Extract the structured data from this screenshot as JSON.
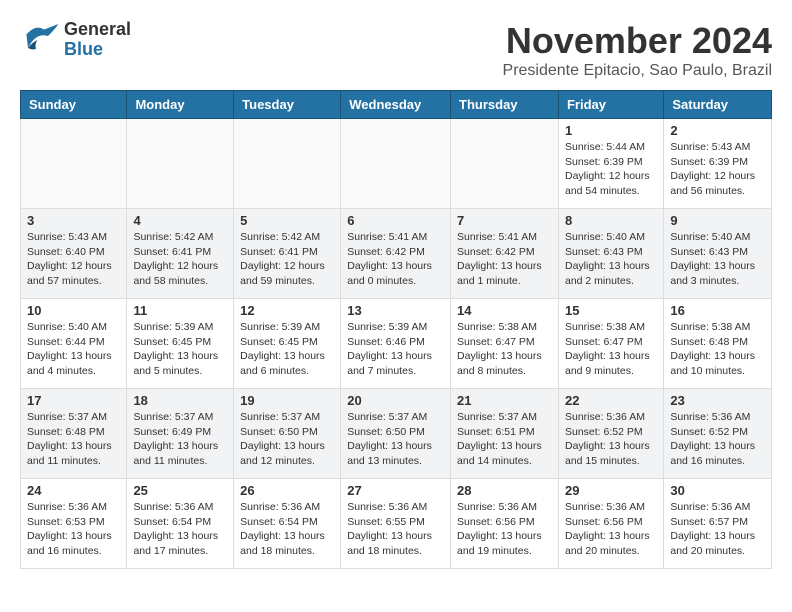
{
  "header": {
    "logo_general": "General",
    "logo_blue": "Blue",
    "month_title": "November 2024",
    "location": "Presidente Epitacio, Sao Paulo, Brazil"
  },
  "weekdays": [
    "Sunday",
    "Monday",
    "Tuesday",
    "Wednesday",
    "Thursday",
    "Friday",
    "Saturday"
  ],
  "weeks": [
    [
      {
        "day": "",
        "info": ""
      },
      {
        "day": "",
        "info": ""
      },
      {
        "day": "",
        "info": ""
      },
      {
        "day": "",
        "info": ""
      },
      {
        "day": "",
        "info": ""
      },
      {
        "day": "1",
        "info": "Sunrise: 5:44 AM\nSunset: 6:39 PM\nDaylight: 12 hours\nand 54 minutes."
      },
      {
        "day": "2",
        "info": "Sunrise: 5:43 AM\nSunset: 6:39 PM\nDaylight: 12 hours\nand 56 minutes."
      }
    ],
    [
      {
        "day": "3",
        "info": "Sunrise: 5:43 AM\nSunset: 6:40 PM\nDaylight: 12 hours\nand 57 minutes."
      },
      {
        "day": "4",
        "info": "Sunrise: 5:42 AM\nSunset: 6:41 PM\nDaylight: 12 hours\nand 58 minutes."
      },
      {
        "day": "5",
        "info": "Sunrise: 5:42 AM\nSunset: 6:41 PM\nDaylight: 12 hours\nand 59 minutes."
      },
      {
        "day": "6",
        "info": "Sunrise: 5:41 AM\nSunset: 6:42 PM\nDaylight: 13 hours\nand 0 minutes."
      },
      {
        "day": "7",
        "info": "Sunrise: 5:41 AM\nSunset: 6:42 PM\nDaylight: 13 hours\nand 1 minute."
      },
      {
        "day": "8",
        "info": "Sunrise: 5:40 AM\nSunset: 6:43 PM\nDaylight: 13 hours\nand 2 minutes."
      },
      {
        "day": "9",
        "info": "Sunrise: 5:40 AM\nSunset: 6:43 PM\nDaylight: 13 hours\nand 3 minutes."
      }
    ],
    [
      {
        "day": "10",
        "info": "Sunrise: 5:40 AM\nSunset: 6:44 PM\nDaylight: 13 hours\nand 4 minutes."
      },
      {
        "day": "11",
        "info": "Sunrise: 5:39 AM\nSunset: 6:45 PM\nDaylight: 13 hours\nand 5 minutes."
      },
      {
        "day": "12",
        "info": "Sunrise: 5:39 AM\nSunset: 6:45 PM\nDaylight: 13 hours\nand 6 minutes."
      },
      {
        "day": "13",
        "info": "Sunrise: 5:39 AM\nSunset: 6:46 PM\nDaylight: 13 hours\nand 7 minutes."
      },
      {
        "day": "14",
        "info": "Sunrise: 5:38 AM\nSunset: 6:47 PM\nDaylight: 13 hours\nand 8 minutes."
      },
      {
        "day": "15",
        "info": "Sunrise: 5:38 AM\nSunset: 6:47 PM\nDaylight: 13 hours\nand 9 minutes."
      },
      {
        "day": "16",
        "info": "Sunrise: 5:38 AM\nSunset: 6:48 PM\nDaylight: 13 hours\nand 10 minutes."
      }
    ],
    [
      {
        "day": "17",
        "info": "Sunrise: 5:37 AM\nSunset: 6:48 PM\nDaylight: 13 hours\nand 11 minutes."
      },
      {
        "day": "18",
        "info": "Sunrise: 5:37 AM\nSunset: 6:49 PM\nDaylight: 13 hours\nand 11 minutes."
      },
      {
        "day": "19",
        "info": "Sunrise: 5:37 AM\nSunset: 6:50 PM\nDaylight: 13 hours\nand 12 minutes."
      },
      {
        "day": "20",
        "info": "Sunrise: 5:37 AM\nSunset: 6:50 PM\nDaylight: 13 hours\nand 13 minutes."
      },
      {
        "day": "21",
        "info": "Sunrise: 5:37 AM\nSunset: 6:51 PM\nDaylight: 13 hours\nand 14 minutes."
      },
      {
        "day": "22",
        "info": "Sunrise: 5:36 AM\nSunset: 6:52 PM\nDaylight: 13 hours\nand 15 minutes."
      },
      {
        "day": "23",
        "info": "Sunrise: 5:36 AM\nSunset: 6:52 PM\nDaylight: 13 hours\nand 16 minutes."
      }
    ],
    [
      {
        "day": "24",
        "info": "Sunrise: 5:36 AM\nSunset: 6:53 PM\nDaylight: 13 hours\nand 16 minutes."
      },
      {
        "day": "25",
        "info": "Sunrise: 5:36 AM\nSunset: 6:54 PM\nDaylight: 13 hours\nand 17 minutes."
      },
      {
        "day": "26",
        "info": "Sunrise: 5:36 AM\nSunset: 6:54 PM\nDaylight: 13 hours\nand 18 minutes."
      },
      {
        "day": "27",
        "info": "Sunrise: 5:36 AM\nSunset: 6:55 PM\nDaylight: 13 hours\nand 18 minutes."
      },
      {
        "day": "28",
        "info": "Sunrise: 5:36 AM\nSunset: 6:56 PM\nDaylight: 13 hours\nand 19 minutes."
      },
      {
        "day": "29",
        "info": "Sunrise: 5:36 AM\nSunset: 6:56 PM\nDaylight: 13 hours\nand 20 minutes."
      },
      {
        "day": "30",
        "info": "Sunrise: 5:36 AM\nSunset: 6:57 PM\nDaylight: 13 hours\nand 20 minutes."
      }
    ]
  ]
}
